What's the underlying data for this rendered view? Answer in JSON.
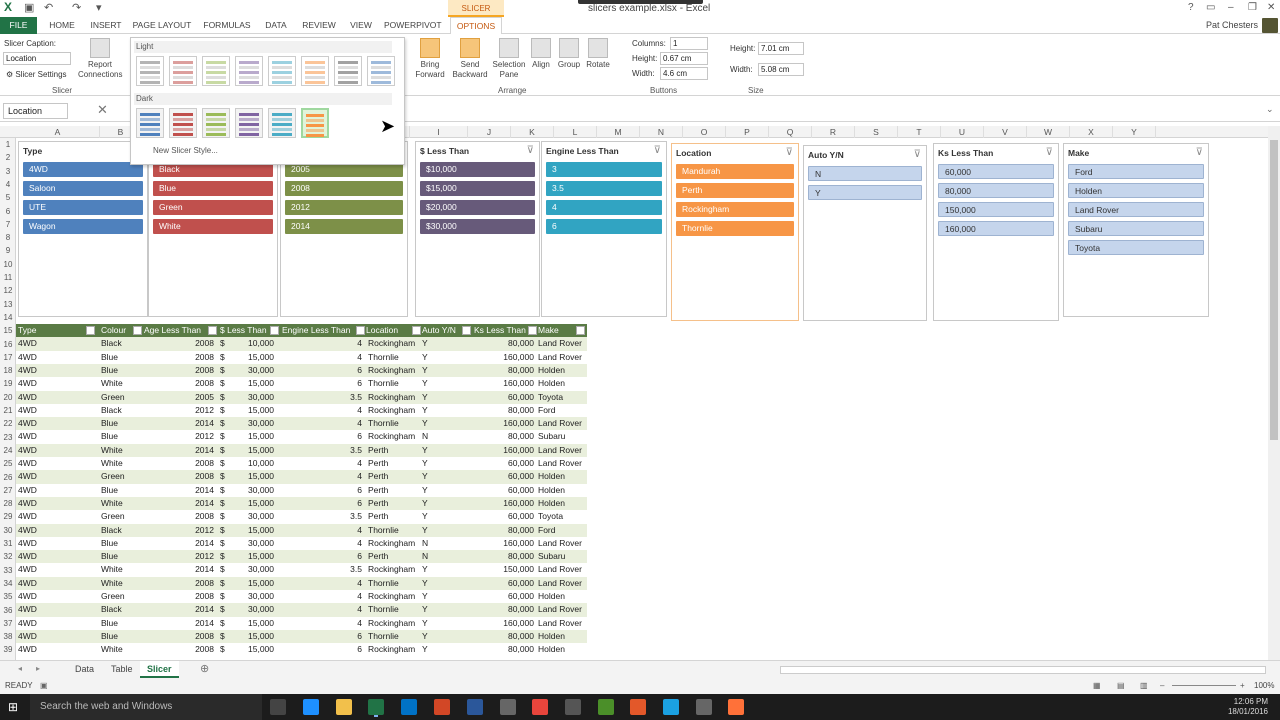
{
  "title": "slicers example.xlsx - Excel",
  "slicer_tools": "SLICER TOOLS",
  "user": "Pat Chesters",
  "tabs": [
    "FILE",
    "HOME",
    "INSERT",
    "PAGE LAYOUT",
    "FORMULAS",
    "DATA",
    "REVIEW",
    "VIEW",
    "POWERPIVOT",
    "OPTIONS"
  ],
  "ribbon": {
    "caption_label": "Slicer Caption:",
    "caption_value": "Location",
    "slicer_settings": "Slicer Settings",
    "report_connections": "Report Connections",
    "group_slicer": "Slicer",
    "bring_forward": "Bring Forward",
    "send_backward": "Send Backward",
    "selection_pane": "Selection Pane",
    "align": "Align",
    "group": "Group",
    "rotate": "Rotate",
    "group_arrange": "Arrange",
    "columns_label": "Columns:",
    "columns_value": "1",
    "btn_height_label": "Height:",
    "btn_height_value": "0.67 cm",
    "btn_width_label": "Width:",
    "btn_width_value": "4.6 cm",
    "group_buttons": "Buttons",
    "size_height_label": "Height:",
    "size_height_value": "7.01 cm",
    "size_width_label": "Width:",
    "size_width_value": "5.08 cm",
    "group_size": "Size"
  },
  "gallery": {
    "light": "Light",
    "dark": "Dark",
    "new_style": "New Slicer Style..."
  },
  "formula": {
    "namebox": "Location"
  },
  "columns": [
    "A",
    "B",
    "C",
    "D",
    "E",
    "F",
    "G",
    "H",
    "I",
    "J",
    "K",
    "L",
    "M",
    "N",
    "O",
    "P",
    "Q",
    "R",
    "S",
    "T",
    "U",
    "V",
    "W",
    "X",
    "Y"
  ],
  "rows": [
    "1",
    "2",
    "3",
    "4",
    "5",
    "6",
    "7",
    "8",
    "9",
    "10",
    "11",
    "12",
    "13",
    "14",
    "15",
    "16",
    "17",
    "18",
    "19",
    "20",
    "21",
    "22",
    "23",
    "24",
    "25",
    "26",
    "27",
    "28",
    "29",
    "30",
    "31",
    "32",
    "33",
    "34",
    "35",
    "36",
    "37",
    "38",
    "39"
  ],
  "slicers": [
    {
      "title": "Type",
      "items": [
        "4WD",
        "Saloon",
        "UTE",
        "Wagon"
      ],
      "color": "#4f81bd"
    },
    {
      "title": "",
      "items": [
        "Black",
        "Blue",
        "Green",
        "White"
      ],
      "color": "#c0504d"
    },
    {
      "title": "",
      "items": [
        "2005",
        "2008",
        "2012",
        "2014"
      ],
      "color": "#7d9048"
    },
    {
      "title": "$ Less Than",
      "items": [
        "$10,000",
        "$15,000",
        "$20,000",
        "$30,000"
      ],
      "color": "#675a7a"
    },
    {
      "title": "Engine Less Than",
      "items": [
        "3",
        "3.5",
        "4",
        "6"
      ],
      "color": "#31a4c2"
    },
    {
      "title": "Location",
      "items": [
        "Mandurah",
        "Perth",
        "Rockingham",
        "Thornlie"
      ],
      "color": "#f79646"
    },
    {
      "title": "Auto Y/N",
      "items": [
        "N",
        "Y"
      ],
      "color": "#c5d5ec"
    },
    {
      "title": "Ks Less Than",
      "items": [
        "60,000",
        "80,000",
        "150,000",
        "160,000"
      ],
      "color": "#c5d5ec"
    },
    {
      "title": "Make",
      "items": [
        "Ford",
        "Holden",
        "Land Rover",
        "Subaru",
        "Toyota"
      ],
      "color": "#c5d5ec"
    }
  ],
  "table": {
    "headers": [
      "Type",
      "Colour",
      "Age Less Than",
      "$ Less Than",
      "Engine Less Than",
      "Location",
      "Auto Y/N",
      "Ks Less Than",
      "Make"
    ],
    "rows": [
      [
        "4WD",
        "Black",
        "2008",
        "$",
        "10,000",
        "4",
        "Rockingham",
        "Y",
        "80,000",
        "Land Rover"
      ],
      [
        "4WD",
        "Blue",
        "2008",
        "$",
        "15,000",
        "4",
        "Thornlie",
        "Y",
        "160,000",
        "Land Rover"
      ],
      [
        "4WD",
        "Blue",
        "2008",
        "$",
        "30,000",
        "6",
        "Rockingham",
        "Y",
        "80,000",
        "Holden"
      ],
      [
        "4WD",
        "White",
        "2008",
        "$",
        "15,000",
        "6",
        "Thornlie",
        "Y",
        "160,000",
        "Holden"
      ],
      [
        "4WD",
        "Green",
        "2005",
        "$",
        "30,000",
        "3.5",
        "Rockingham",
        "Y",
        "60,000",
        "Toyota"
      ],
      [
        "4WD",
        "Black",
        "2012",
        "$",
        "15,000",
        "4",
        "Rockingham",
        "Y",
        "80,000",
        "Ford"
      ],
      [
        "4WD",
        "Blue",
        "2014",
        "$",
        "30,000",
        "4",
        "Thornlie",
        "Y",
        "160,000",
        "Land Rover"
      ],
      [
        "4WD",
        "Blue",
        "2012",
        "$",
        "15,000",
        "6",
        "Rockingham",
        "N",
        "80,000",
        "Subaru"
      ],
      [
        "4WD",
        "White",
        "2014",
        "$",
        "15,000",
        "3.5",
        "Perth",
        "Y",
        "160,000",
        "Land Rover"
      ],
      [
        "4WD",
        "White",
        "2008",
        "$",
        "10,000",
        "4",
        "Perth",
        "Y",
        "60,000",
        "Land Rover"
      ],
      [
        "4WD",
        "Green",
        "2008",
        "$",
        "15,000",
        "4",
        "Perth",
        "Y",
        "60,000",
        "Holden"
      ],
      [
        "4WD",
        "Blue",
        "2014",
        "$",
        "30,000",
        "6",
        "Perth",
        "Y",
        "60,000",
        "Holden"
      ],
      [
        "4WD",
        "White",
        "2014",
        "$",
        "15,000",
        "6",
        "Perth",
        "Y",
        "160,000",
        "Holden"
      ],
      [
        "4WD",
        "Green",
        "2008",
        "$",
        "30,000",
        "3.5",
        "Perth",
        "Y",
        "60,000",
        "Toyota"
      ],
      [
        "4WD",
        "Black",
        "2012",
        "$",
        "15,000",
        "4",
        "Thornlie",
        "Y",
        "80,000",
        "Ford"
      ],
      [
        "4WD",
        "Blue",
        "2014",
        "$",
        "30,000",
        "4",
        "Rockingham",
        "N",
        "160,000",
        "Land Rover"
      ],
      [
        "4WD",
        "Blue",
        "2012",
        "$",
        "15,000",
        "6",
        "Perth",
        "N",
        "80,000",
        "Subaru"
      ],
      [
        "4WD",
        "White",
        "2014",
        "$",
        "30,000",
        "3.5",
        "Rockingham",
        "Y",
        "150,000",
        "Land Rover"
      ],
      [
        "4WD",
        "White",
        "2008",
        "$",
        "15,000",
        "4",
        "Thornlie",
        "Y",
        "60,000",
        "Land Rover"
      ],
      [
        "4WD",
        "Green",
        "2008",
        "$",
        "30,000",
        "4",
        "Rockingham",
        "Y",
        "60,000",
        "Holden"
      ],
      [
        "4WD",
        "Black",
        "2014",
        "$",
        "30,000",
        "4",
        "Thornlie",
        "Y",
        "80,000",
        "Land Rover"
      ],
      [
        "4WD",
        "Blue",
        "2014",
        "$",
        "15,000",
        "4",
        "Rockingham",
        "Y",
        "160,000",
        "Land Rover"
      ],
      [
        "4WD",
        "Blue",
        "2008",
        "$",
        "15,000",
        "6",
        "Thornlie",
        "Y",
        "80,000",
        "Holden"
      ],
      [
        "4WD",
        "White",
        "2008",
        "$",
        "15,000",
        "6",
        "Rockingham",
        "Y",
        "80,000",
        "Holden"
      ]
    ]
  },
  "sheets": [
    "Data",
    "Table",
    "Slicer"
  ],
  "status": {
    "ready": "READY",
    "zoom": "100%"
  },
  "taskbar": {
    "search": "Search the web and Windows",
    "time": "12:06 PM",
    "date": "18/01/2016"
  }
}
